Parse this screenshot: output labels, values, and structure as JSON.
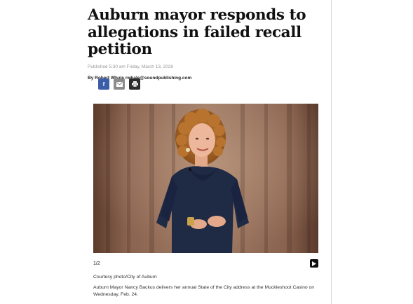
{
  "article": {
    "headline": "Auburn mayor responds to allegations in failed recall petition",
    "published": "Published 5:30 am Friday, March 13, 2026",
    "byline_prefix": "By ",
    "author": "Robert Whale",
    "author_email": "rwhale@soundpublishing.com"
  },
  "share": {
    "facebook_glyph": "f",
    "icons": [
      "facebook-icon",
      "email-icon",
      "print-icon"
    ]
  },
  "gallery": {
    "counter": "1/2",
    "credit": "Courtesy photo/City of Auburn",
    "caption": "Auburn Mayor Nancy Backus delivers her annual State of the City address at the Muckleshoot Casino on Wednesday, Feb. 24."
  },
  "colors": {
    "facebook": "#3b5ca8",
    "email": "#8c8c8c",
    "print": "#2b2b2b",
    "divider": "#d8d8d8"
  }
}
